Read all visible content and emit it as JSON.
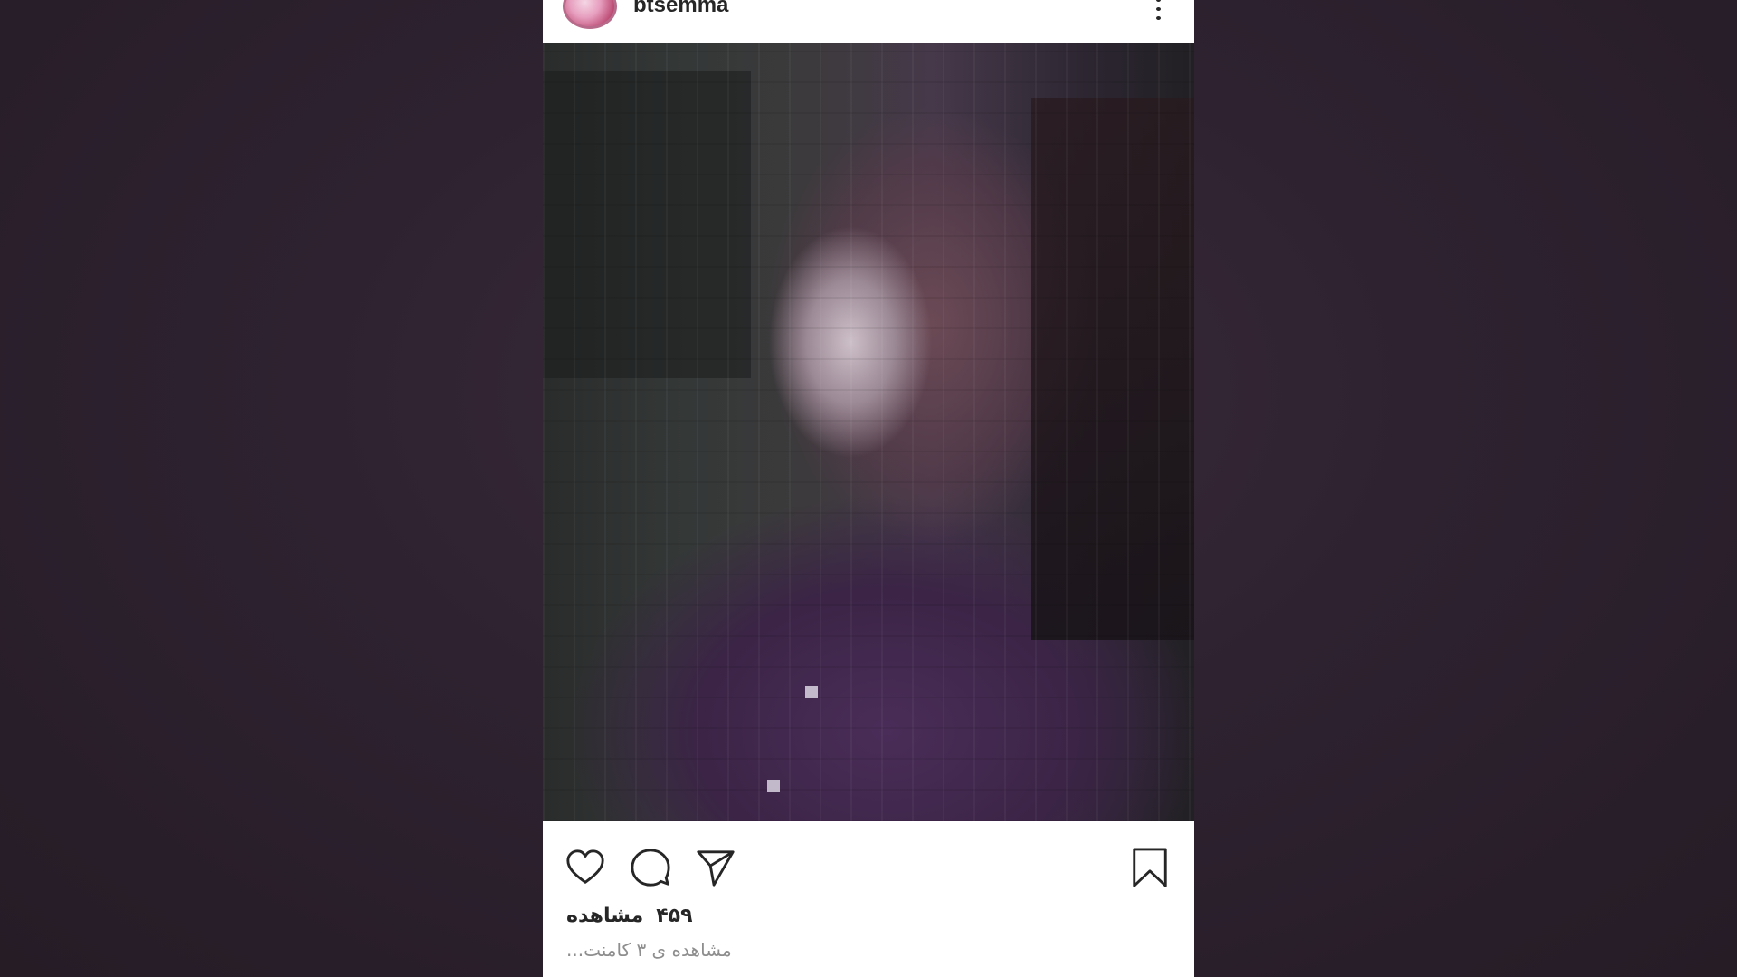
{
  "post": {
    "username": "btsemma",
    "avatar_icon": "profile-avatar",
    "more_icon": "more-vertical-icon"
  },
  "actions": {
    "like_icon": "heart-icon",
    "comment_icon": "comment-icon",
    "share_icon": "send-icon",
    "save_icon": "bookmark-icon"
  },
  "stats": {
    "views_count": "۴۵۹",
    "views_label": "مشاهده",
    "comments_text": "مشاهده ی ۳ کامنت..."
  },
  "colors": {
    "page_background": "#2e2230",
    "card_background": "#ffffff",
    "text_primary": "#262626",
    "text_secondary": "#8e8e8e"
  }
}
